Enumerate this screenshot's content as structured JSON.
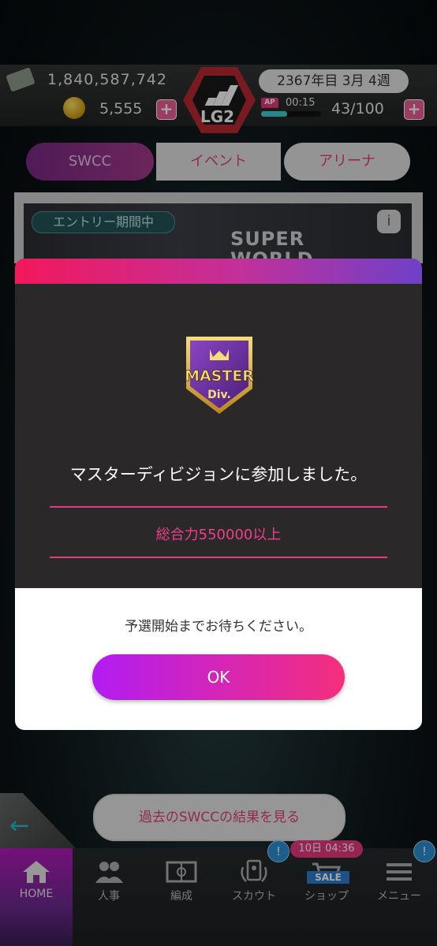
{
  "header": {
    "money": "1,840,587,742",
    "coins": "5,555",
    "plus": "+",
    "logo_text": "LG2",
    "date": "2367年目 3月 4週",
    "ap_label": "AP",
    "ap_timer": "00:15",
    "ap_count": "43/100",
    "ap_fill_fraction": 0.43
  },
  "tabs": [
    {
      "label": "SWCC"
    },
    {
      "label": "イベント"
    },
    {
      "label": "アリーナ"
    }
  ],
  "banner": {
    "entry_label": "エントリー期間中",
    "title_fragment": "SUPER\nWORLD",
    "info": "i"
  },
  "modal": {
    "badge_line1": "MASTER",
    "badge_line2": "Div.",
    "title": "マスターディビジョンに参加しました。",
    "requirement": "総合力550000以上",
    "message": "予選開始までお待ちください。",
    "ok_label": "OK"
  },
  "bottom": {
    "back_arrow": "←",
    "past_results_label": "過去のSWCCの結果を見る",
    "shop_timer": "10日 04:36",
    "sale_label": "SALE",
    "notif_mark": "!"
  },
  "nav": [
    {
      "label": "HOME",
      "icon": "home-icon"
    },
    {
      "label": "人事",
      "icon": "people-icon"
    },
    {
      "label": "編成",
      "icon": "field-icon"
    },
    {
      "label": "スカウト",
      "icon": "scout-icon"
    },
    {
      "label": "ショップ",
      "icon": "cart-icon"
    },
    {
      "label": "メニュー",
      "icon": "menu-icon"
    }
  ],
  "colors": {
    "accent_pink": "#e43c82",
    "accent_purple": "#b21cf2",
    "modal_dark": "#2b2829"
  }
}
